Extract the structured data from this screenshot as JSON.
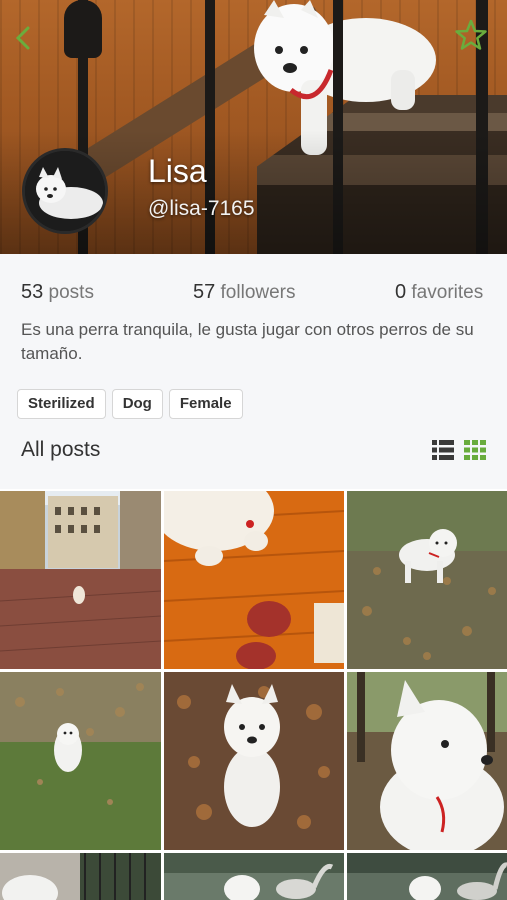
{
  "profile": {
    "name": "Lisa",
    "username": "@lisa-7165"
  },
  "stats": {
    "posts_count": "53",
    "posts_label": "posts",
    "followers_count": "57",
    "followers_label": "followers",
    "favorites_count": "0",
    "favorites_label": "favorites"
  },
  "bio": "Es una perra tranquila, le gusta jugar con otros perros de su tamaño.",
  "tags": [
    "Sterilized",
    "Dog",
    "Female"
  ],
  "section": {
    "title": "All posts"
  },
  "icons": {
    "back": "chevron-left-icon",
    "favorite": "star-outline-icon",
    "list_view": "list-view-icon",
    "grid_view": "grid-view-icon"
  },
  "colors": {
    "accent": "#6aad3d",
    "panel_bg": "#f6f7f9",
    "text": "#333333"
  },
  "posts": [
    "street-square-dog-photo",
    "dog-lying-wooden-floor-photo",
    "dog-standing-leaves-photo",
    "dog-grass-leaves-photo",
    "dog-autumn-leaves-photo",
    "dog-closeup-park-photo",
    "dog-by-fence-photo",
    "dog-swan-pond-photo",
    "dog-swans-lake-photo"
  ]
}
